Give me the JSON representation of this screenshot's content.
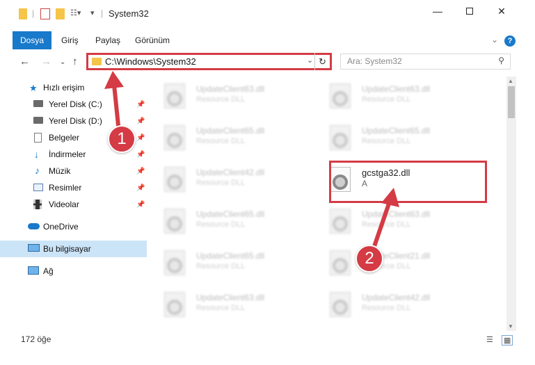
{
  "window": {
    "title": "System32",
    "minimize_icon": "minimize-icon",
    "maximize_icon": "maximize-icon",
    "close_icon": "close-icon"
  },
  "ribbon": {
    "tabs": [
      "Dosya",
      "Giriş",
      "Paylaş",
      "Görünüm"
    ]
  },
  "address": {
    "path": "C:\\Windows\\System32",
    "search_placeholder": "Ara: System32"
  },
  "sidebar": {
    "items": [
      {
        "label": "Hızlı erişim",
        "icon": "star-icon",
        "pinned": false
      },
      {
        "label": "Yerel Disk (C:)",
        "icon": "drive-icon",
        "pinned": true
      },
      {
        "label": "Yerel Disk (D:)",
        "icon": "drive-icon",
        "pinned": true
      },
      {
        "label": "Belgeler",
        "icon": "documents-icon",
        "pinned": true
      },
      {
        "label": "İndirmeler",
        "icon": "download-icon",
        "pinned": true
      },
      {
        "label": "Müzik",
        "icon": "music-icon",
        "pinned": true
      },
      {
        "label": "Resimler",
        "icon": "pictures-icon",
        "pinned": true
      },
      {
        "label": "Videolar",
        "icon": "videos-icon",
        "pinned": true
      },
      {
        "label": "OneDrive",
        "icon": "cloud-icon",
        "pinned": false
      },
      {
        "label": "Bu bilgisayar",
        "icon": "computer-icon",
        "pinned": false
      },
      {
        "label": "Ağ",
        "icon": "network-icon",
        "pinned": false
      }
    ]
  },
  "files": {
    "left": [
      {
        "name": "UpdateClient63.dll",
        "desc": "Resource DLL"
      },
      {
        "name": "UpdateClient65.dll",
        "desc": "Resource DLL"
      },
      {
        "name": "UpdateClient42.dll",
        "desc": "Resource DLL"
      },
      {
        "name": "UpdateClient65.dll",
        "desc": "Resource DLL"
      },
      {
        "name": "UpdateClient65.dll",
        "desc": "Resource DLL"
      },
      {
        "name": "UpdateClient63.dll",
        "desc": "Resource DLL"
      }
    ],
    "right": [
      {
        "name": "UpdateClient63.dll",
        "desc": "Resource DLL"
      },
      {
        "name": "UpdateClient65.dll",
        "desc": "Resource DLL"
      },
      {
        "name": "gcstga32.dll",
        "desc": "A"
      },
      {
        "name": "UpdateClient63.dll",
        "desc": "Resource DLL"
      },
      {
        "name": "UpdateClient21.dll",
        "desc": "Resource DLL"
      },
      {
        "name": "UpdateClient42.dll",
        "desc": "Resource DLL"
      }
    ]
  },
  "status": {
    "count": "172 öğe"
  },
  "annotations": {
    "step1": "1",
    "step2": "2",
    "color": "#d43b45"
  }
}
